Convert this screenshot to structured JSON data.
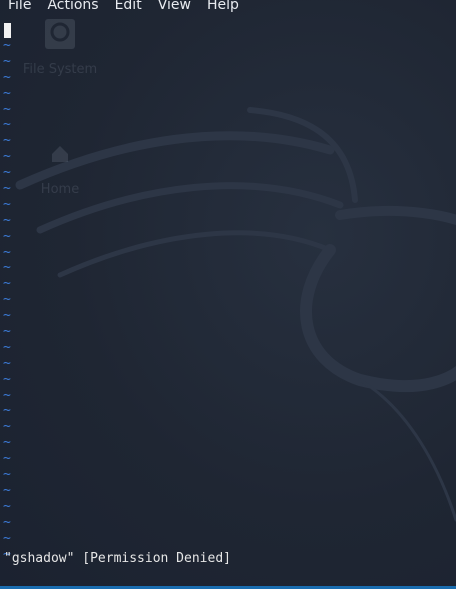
{
  "menu": {
    "items": [
      "File",
      "Actions",
      "Edit",
      "View",
      "Help"
    ]
  },
  "desktop": {
    "icons": [
      {
        "label": "File System",
        "icon": "drive-icon"
      },
      {
        "label": "Home",
        "icon": "home-folder-icon"
      }
    ]
  },
  "vim": {
    "empty_line_marker": "~",
    "empty_line_count": 33,
    "status_message": "\"gshadow\" [Permission Denied]"
  },
  "colors": {
    "background": "#1f2633",
    "tilde": "#3c7bd8",
    "menu_text": "#e8ebf0",
    "status_text": "#e6e6e6",
    "taskbar_accent": "#1a6db0"
  }
}
